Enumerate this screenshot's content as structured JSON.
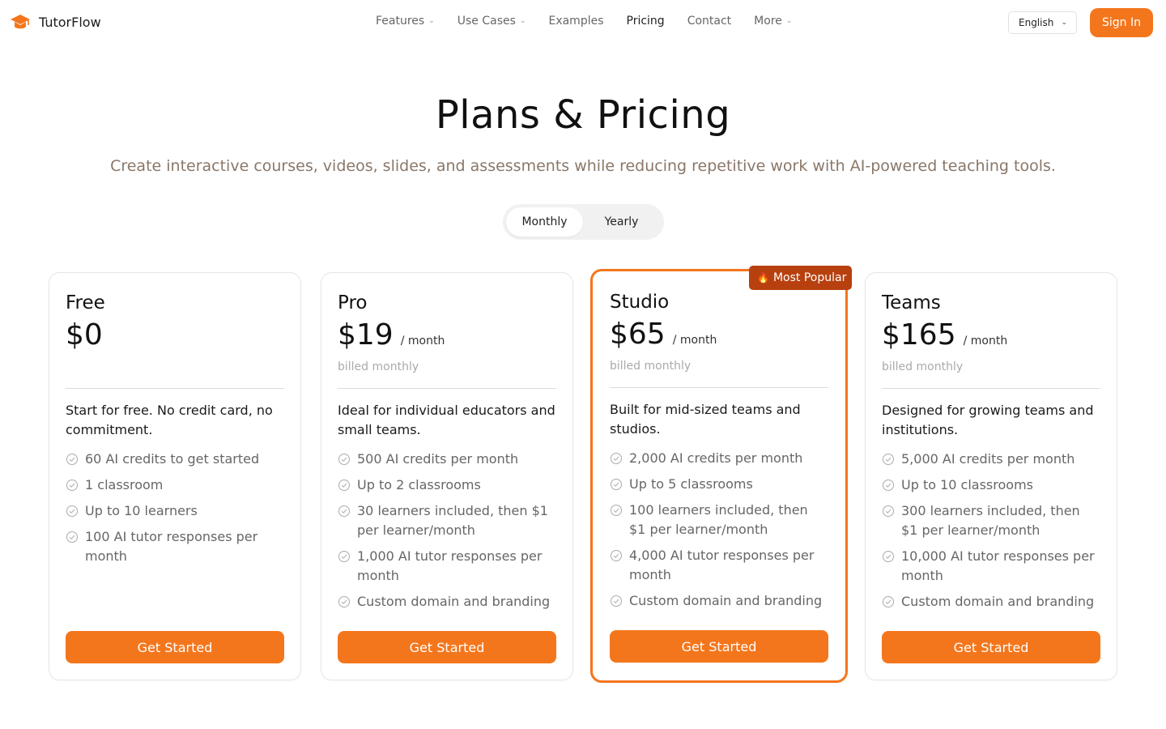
{
  "brand": {
    "name": "TutorFlow",
    "color": "#f4761c"
  },
  "nav": {
    "items": [
      {
        "label": "Features",
        "dropdown": true,
        "active": false
      },
      {
        "label": "Use Cases",
        "dropdown": true,
        "active": false
      },
      {
        "label": "Examples",
        "dropdown": false,
        "active": false
      },
      {
        "label": "Pricing",
        "dropdown": false,
        "active": true
      },
      {
        "label": "Contact",
        "dropdown": false,
        "active": false
      },
      {
        "label": "More",
        "dropdown": true,
        "active": false
      }
    ]
  },
  "header": {
    "language": "English",
    "signin_label": "Sign In"
  },
  "hero": {
    "title": "Plans & Pricing",
    "subtitle": "Create interactive courses, videos, slides, and assessments while reducing repetitive work with AI-powered teaching tools."
  },
  "billing_toggle": {
    "monthly": "Monthly",
    "yearly": "Yearly",
    "selected": "Monthly"
  },
  "badge": {
    "icon": "fire-icon",
    "label": "Most Popular"
  },
  "plans": [
    {
      "name": "Free",
      "price": "$0",
      "per": "",
      "billed": "",
      "description": "Start for free. No credit card, no commitment.",
      "features": [
        "60 AI credits to get started",
        "1 classroom",
        "Up to 10 learners",
        "100 AI tutor responses per month"
      ],
      "cta": "Get Started"
    },
    {
      "name": "Pro",
      "price": "$19",
      "per": "/ month",
      "billed": "billed monthly",
      "description": "Ideal for individual educators and small teams.",
      "features": [
        "500 AI credits per month",
        "Up to 2 classrooms",
        "30 learners included, then $1 per learner/month",
        "1,000 AI tutor responses per month",
        "Custom domain and branding"
      ],
      "cta": "Get Started"
    },
    {
      "name": "Studio",
      "price": "$65",
      "per": "/ month",
      "billed": "billed monthly",
      "description": "Built for mid-sized teams and studios.",
      "features": [
        "2,000 AI credits per month",
        "Up to 5 classrooms",
        "100 learners included, then $1 per learner/month",
        "4,000 AI tutor responses per month",
        "Custom domain and branding"
      ],
      "cta": "Get Started"
    },
    {
      "name": "Teams",
      "price": "$165",
      "per": "/ month",
      "billed": "billed monthly",
      "description": "Designed for growing teams and institutions.",
      "features": [
        "5,000 AI credits per month",
        "Up to 10 classrooms",
        "300 learners included, then $1 per learner/month",
        "10,000 AI tutor responses per month",
        "Custom domain and branding"
      ],
      "cta": "Get Started"
    }
  ]
}
